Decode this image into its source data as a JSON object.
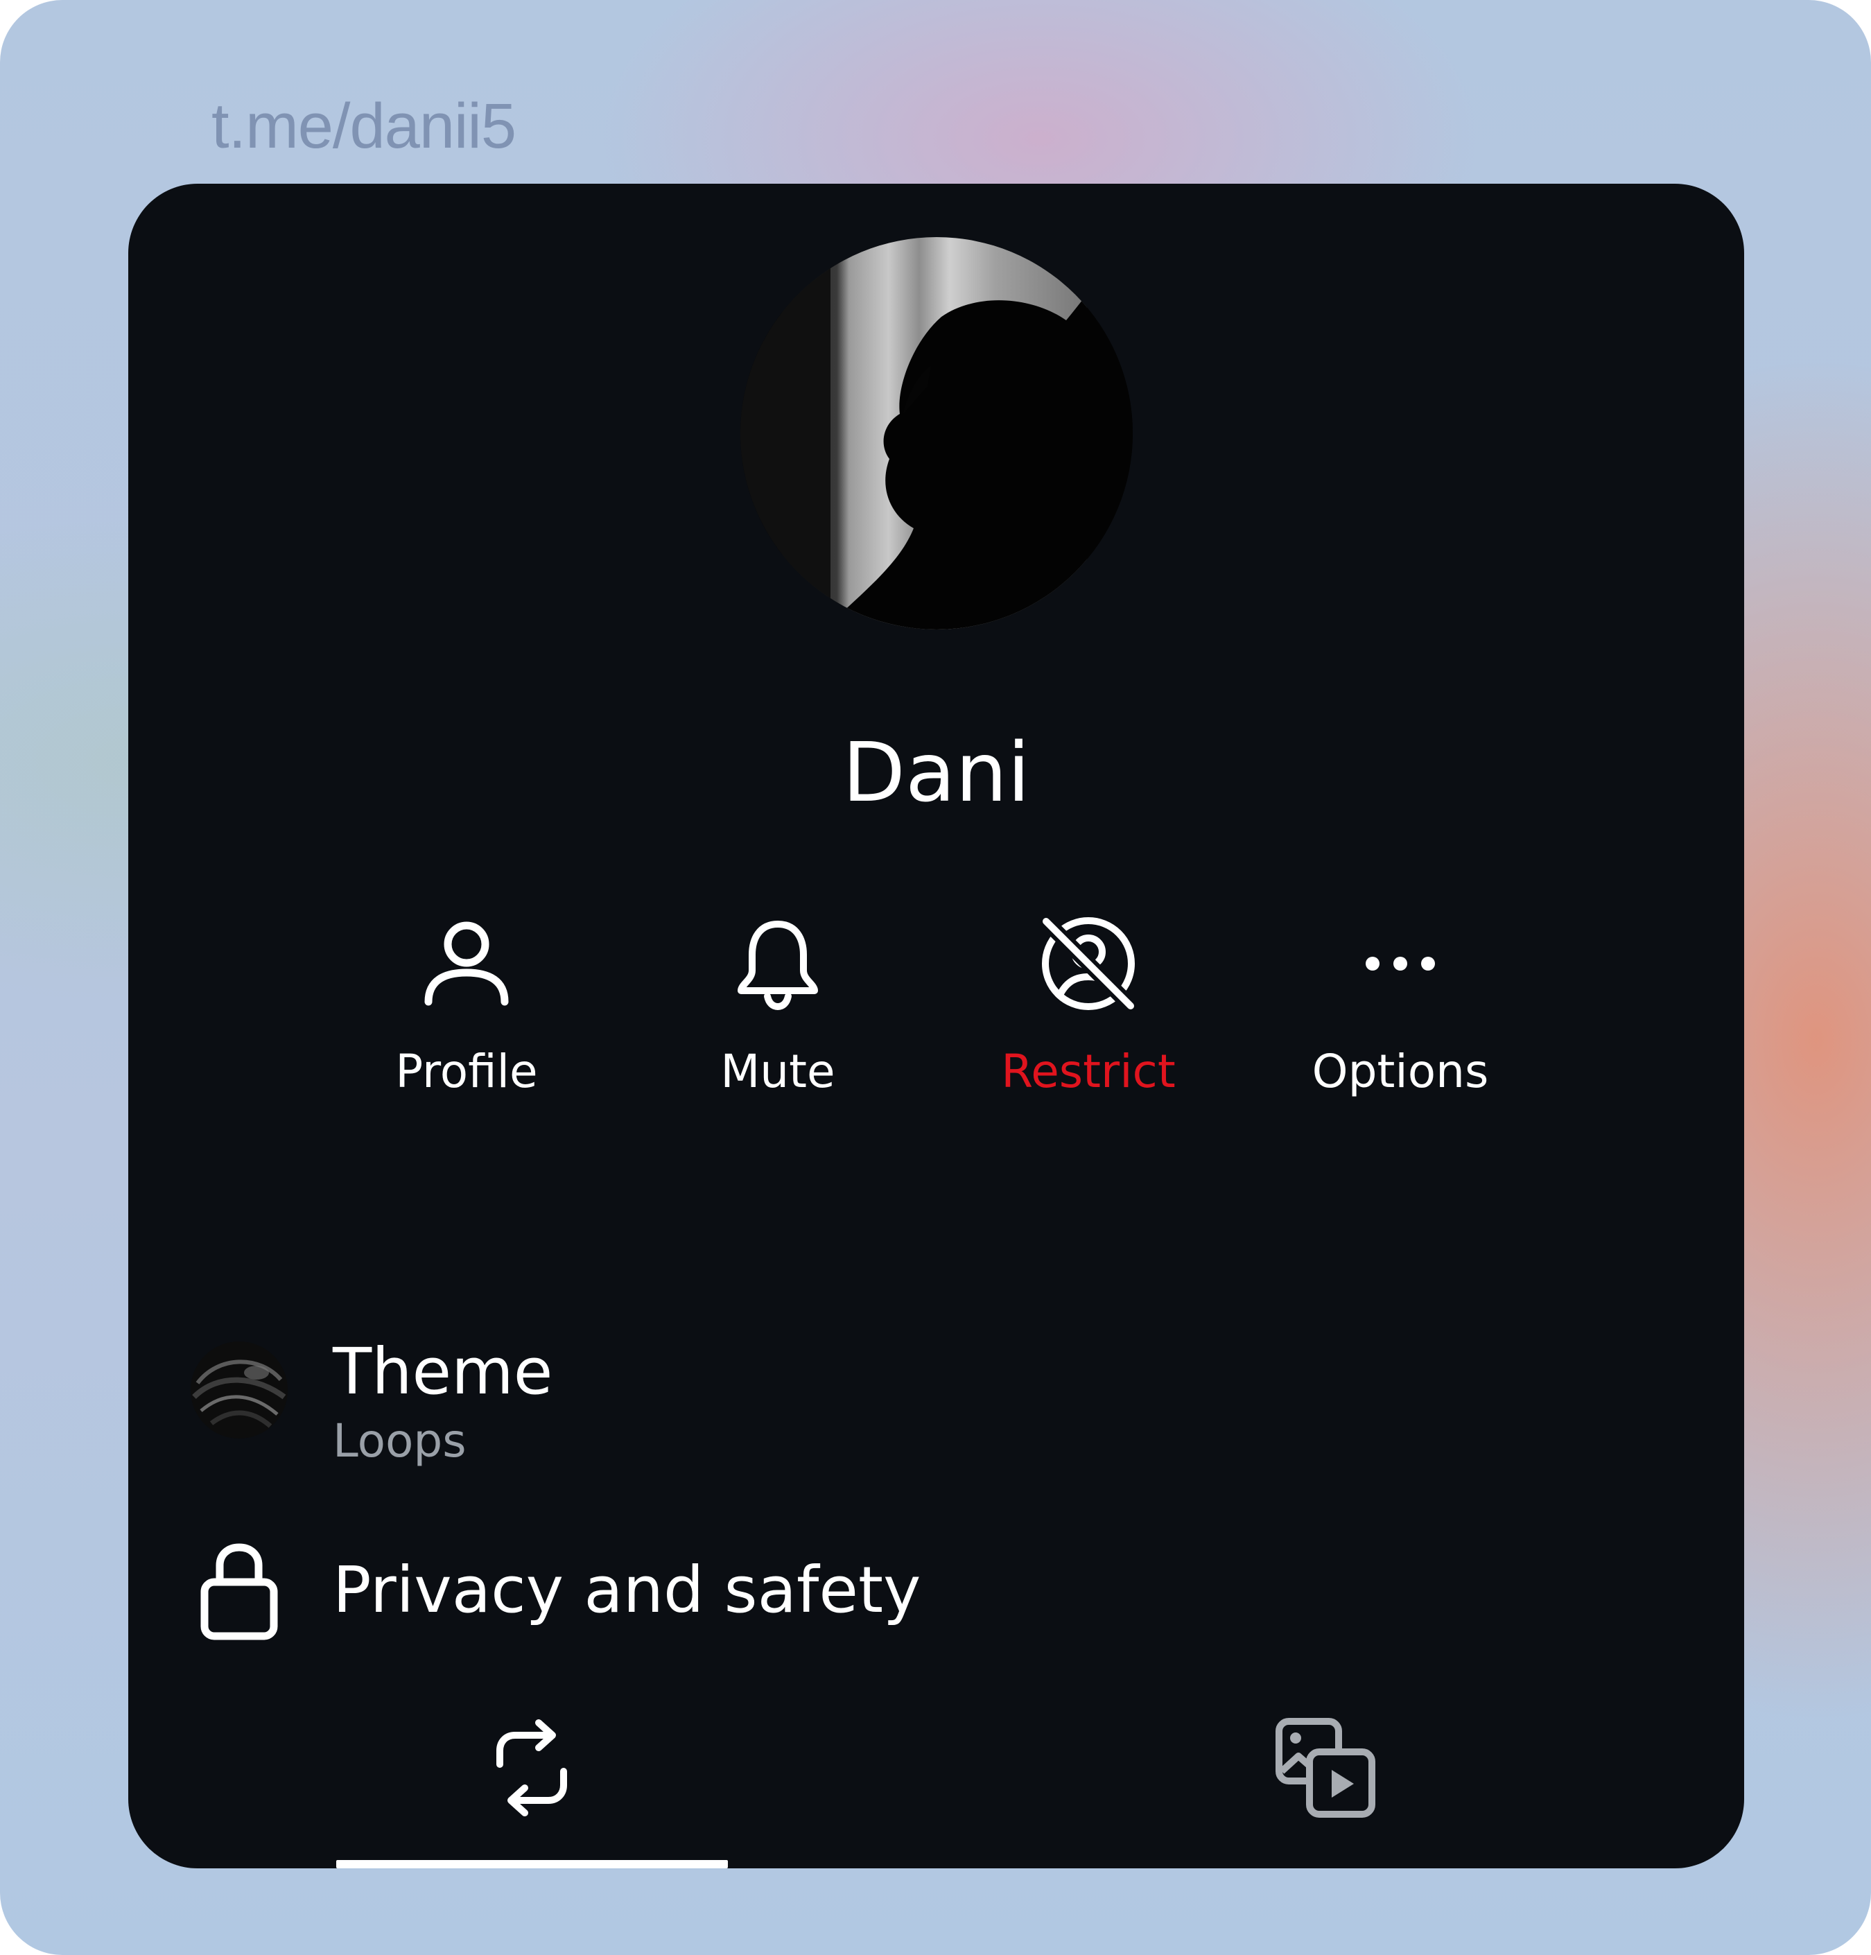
{
  "url": {
    "text": "t.me/danii5"
  },
  "profile": {
    "name": "Dani"
  },
  "actions": [
    {
      "label": "Profile",
      "icon": "person-icon"
    },
    {
      "label": "Mute",
      "icon": "bell-icon"
    },
    {
      "label": "Restrict",
      "icon": "restrict-icon",
      "color": "#e0141e"
    },
    {
      "label": "Options",
      "icon": "more-dots-icon"
    }
  ],
  "settings": {
    "theme": {
      "title": "Theme",
      "value": "Loops"
    },
    "privacy": {
      "title": "Privacy and safety",
      "icon": "lock-icon"
    }
  },
  "tabs": [
    {
      "icon": "repost-icon",
      "selected": true
    },
    {
      "icon": "media-icon",
      "selected": false
    }
  ],
  "colors": {
    "card_bg": "#0b0e13",
    "text": "#ffffff",
    "muted": "#9aa0a8",
    "danger": "#e0141e"
  }
}
